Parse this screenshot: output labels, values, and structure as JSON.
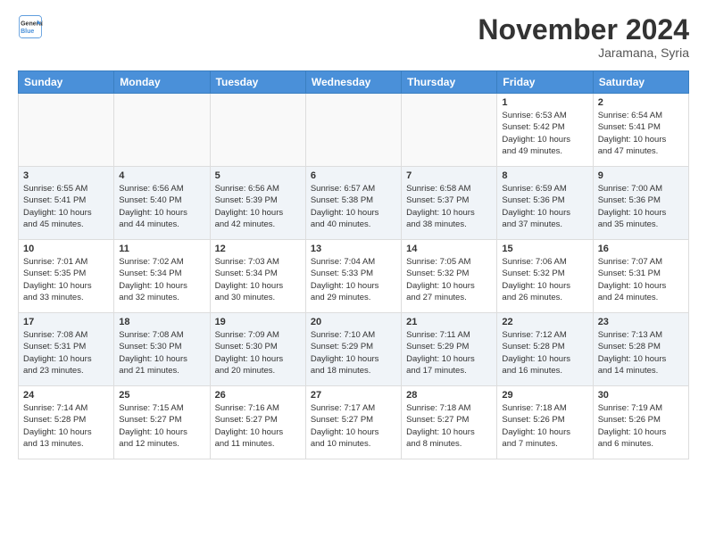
{
  "header": {
    "logo_line1": "General",
    "logo_line2": "Blue",
    "month": "November 2024",
    "location": "Jaramana, Syria"
  },
  "weekdays": [
    "Sunday",
    "Monday",
    "Tuesday",
    "Wednesday",
    "Thursday",
    "Friday",
    "Saturday"
  ],
  "weeks": [
    [
      {
        "day": "",
        "info": ""
      },
      {
        "day": "",
        "info": ""
      },
      {
        "day": "",
        "info": ""
      },
      {
        "day": "",
        "info": ""
      },
      {
        "day": "",
        "info": ""
      },
      {
        "day": "1",
        "info": "Sunrise: 6:53 AM\nSunset: 5:42 PM\nDaylight: 10 hours\nand 49 minutes."
      },
      {
        "day": "2",
        "info": "Sunrise: 6:54 AM\nSunset: 5:41 PM\nDaylight: 10 hours\nand 47 minutes."
      }
    ],
    [
      {
        "day": "3",
        "info": "Sunrise: 6:55 AM\nSunset: 5:41 PM\nDaylight: 10 hours\nand 45 minutes."
      },
      {
        "day": "4",
        "info": "Sunrise: 6:56 AM\nSunset: 5:40 PM\nDaylight: 10 hours\nand 44 minutes."
      },
      {
        "day": "5",
        "info": "Sunrise: 6:56 AM\nSunset: 5:39 PM\nDaylight: 10 hours\nand 42 minutes."
      },
      {
        "day": "6",
        "info": "Sunrise: 6:57 AM\nSunset: 5:38 PM\nDaylight: 10 hours\nand 40 minutes."
      },
      {
        "day": "7",
        "info": "Sunrise: 6:58 AM\nSunset: 5:37 PM\nDaylight: 10 hours\nand 38 minutes."
      },
      {
        "day": "8",
        "info": "Sunrise: 6:59 AM\nSunset: 5:36 PM\nDaylight: 10 hours\nand 37 minutes."
      },
      {
        "day": "9",
        "info": "Sunrise: 7:00 AM\nSunset: 5:36 PM\nDaylight: 10 hours\nand 35 minutes."
      }
    ],
    [
      {
        "day": "10",
        "info": "Sunrise: 7:01 AM\nSunset: 5:35 PM\nDaylight: 10 hours\nand 33 minutes."
      },
      {
        "day": "11",
        "info": "Sunrise: 7:02 AM\nSunset: 5:34 PM\nDaylight: 10 hours\nand 32 minutes."
      },
      {
        "day": "12",
        "info": "Sunrise: 7:03 AM\nSunset: 5:34 PM\nDaylight: 10 hours\nand 30 minutes."
      },
      {
        "day": "13",
        "info": "Sunrise: 7:04 AM\nSunset: 5:33 PM\nDaylight: 10 hours\nand 29 minutes."
      },
      {
        "day": "14",
        "info": "Sunrise: 7:05 AM\nSunset: 5:32 PM\nDaylight: 10 hours\nand 27 minutes."
      },
      {
        "day": "15",
        "info": "Sunrise: 7:06 AM\nSunset: 5:32 PM\nDaylight: 10 hours\nand 26 minutes."
      },
      {
        "day": "16",
        "info": "Sunrise: 7:07 AM\nSunset: 5:31 PM\nDaylight: 10 hours\nand 24 minutes."
      }
    ],
    [
      {
        "day": "17",
        "info": "Sunrise: 7:08 AM\nSunset: 5:31 PM\nDaylight: 10 hours\nand 23 minutes."
      },
      {
        "day": "18",
        "info": "Sunrise: 7:08 AM\nSunset: 5:30 PM\nDaylight: 10 hours\nand 21 minutes."
      },
      {
        "day": "19",
        "info": "Sunrise: 7:09 AM\nSunset: 5:30 PM\nDaylight: 10 hours\nand 20 minutes."
      },
      {
        "day": "20",
        "info": "Sunrise: 7:10 AM\nSunset: 5:29 PM\nDaylight: 10 hours\nand 18 minutes."
      },
      {
        "day": "21",
        "info": "Sunrise: 7:11 AM\nSunset: 5:29 PM\nDaylight: 10 hours\nand 17 minutes."
      },
      {
        "day": "22",
        "info": "Sunrise: 7:12 AM\nSunset: 5:28 PM\nDaylight: 10 hours\nand 16 minutes."
      },
      {
        "day": "23",
        "info": "Sunrise: 7:13 AM\nSunset: 5:28 PM\nDaylight: 10 hours\nand 14 minutes."
      }
    ],
    [
      {
        "day": "24",
        "info": "Sunrise: 7:14 AM\nSunset: 5:28 PM\nDaylight: 10 hours\nand 13 minutes."
      },
      {
        "day": "25",
        "info": "Sunrise: 7:15 AM\nSunset: 5:27 PM\nDaylight: 10 hours\nand 12 minutes."
      },
      {
        "day": "26",
        "info": "Sunrise: 7:16 AM\nSunset: 5:27 PM\nDaylight: 10 hours\nand 11 minutes."
      },
      {
        "day": "27",
        "info": "Sunrise: 7:17 AM\nSunset: 5:27 PM\nDaylight: 10 hours\nand 10 minutes."
      },
      {
        "day": "28",
        "info": "Sunrise: 7:18 AM\nSunset: 5:27 PM\nDaylight: 10 hours\nand 8 minutes."
      },
      {
        "day": "29",
        "info": "Sunrise: 7:18 AM\nSunset: 5:26 PM\nDaylight: 10 hours\nand 7 minutes."
      },
      {
        "day": "30",
        "info": "Sunrise: 7:19 AM\nSunset: 5:26 PM\nDaylight: 10 hours\nand 6 minutes."
      }
    ]
  ]
}
